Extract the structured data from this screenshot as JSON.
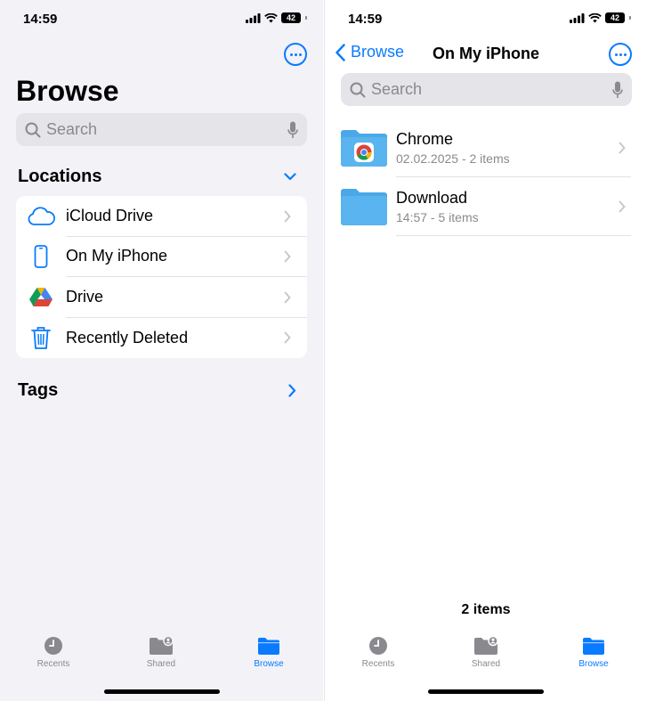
{
  "colors": {
    "accent": "#0a7aff",
    "folder": "#5ab4ef",
    "inactive_tab": "#8a8a8e"
  },
  "left": {
    "status": {
      "time": "14:59",
      "battery": "42"
    },
    "title": "Browse",
    "search": {
      "placeholder": "Search"
    },
    "locations": {
      "title": "Locations",
      "items": [
        {
          "label": "iCloud Drive",
          "icon": "icloud-icon"
        },
        {
          "label": "On My iPhone",
          "icon": "iphone-icon"
        },
        {
          "label": "Drive",
          "icon": "google-drive-icon"
        },
        {
          "label": "Recently Deleted",
          "icon": "trash-icon"
        }
      ]
    },
    "tags": {
      "title": "Tags"
    },
    "tabs": [
      {
        "label": "Recents",
        "icon": "clock-icon"
      },
      {
        "label": "Shared",
        "icon": "shared-folder-icon"
      },
      {
        "label": "Browse",
        "icon": "folder-icon",
        "active": true
      }
    ]
  },
  "right": {
    "status": {
      "time": "14:59",
      "battery": "42"
    },
    "nav": {
      "back_label": "Browse",
      "title": "On My iPhone"
    },
    "search": {
      "placeholder": "Search"
    },
    "files": [
      {
        "name": "Chrome",
        "meta": "02.02.2025 - 2 items",
        "icon": "chrome-folder-icon"
      },
      {
        "name": "Download",
        "meta": "14:57 - 5 items",
        "icon": "folder-icon"
      }
    ],
    "item_count": "2 items",
    "tabs": [
      {
        "label": "Recents",
        "icon": "clock-icon"
      },
      {
        "label": "Shared",
        "icon": "shared-folder-icon"
      },
      {
        "label": "Browse",
        "icon": "folder-icon",
        "active": true
      }
    ]
  }
}
